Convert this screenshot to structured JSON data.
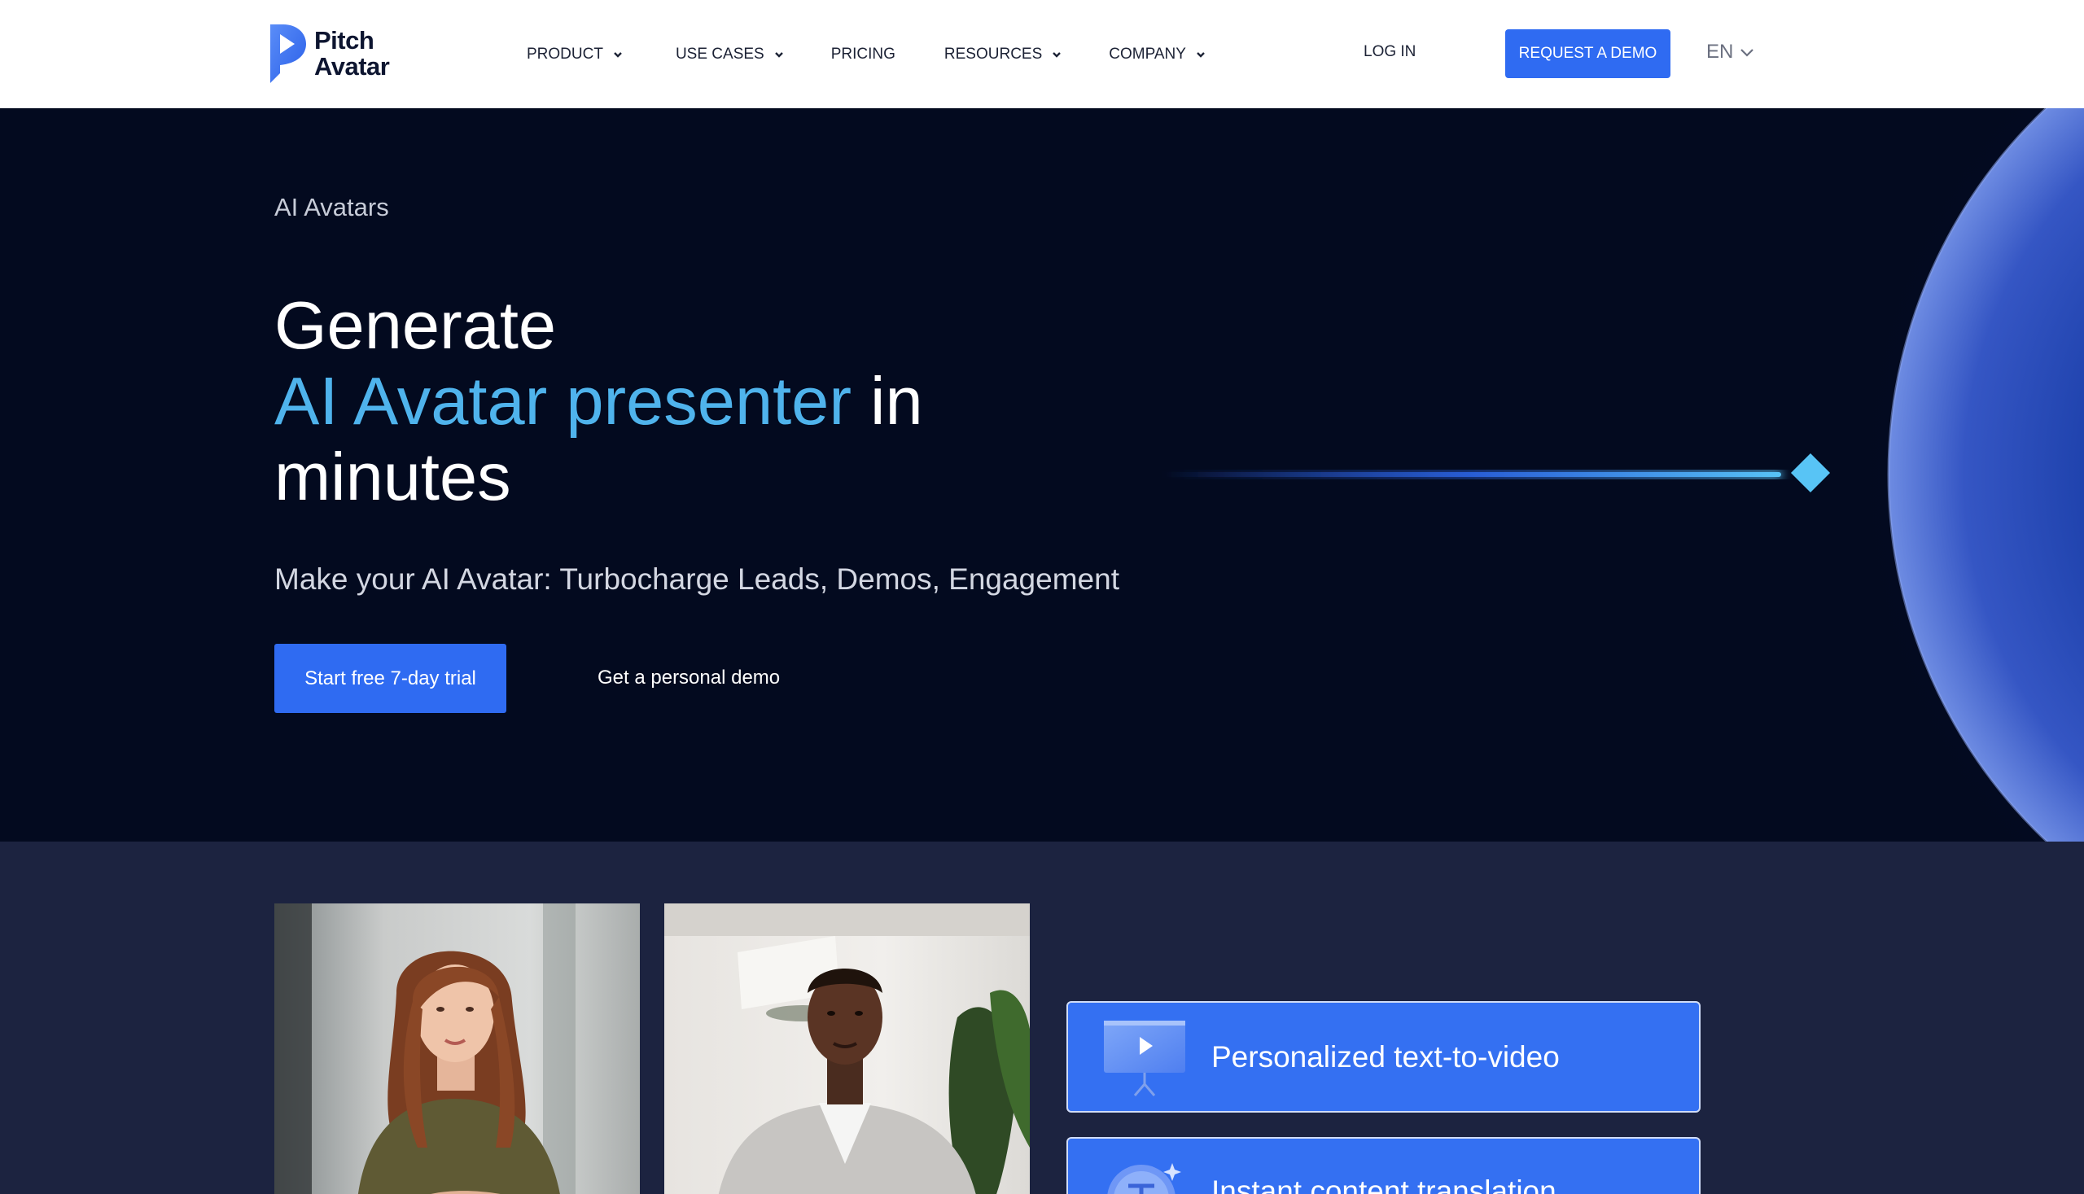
{
  "header": {
    "logo": {
      "line1": "Pitch",
      "line2": "Avatar"
    },
    "nav": [
      {
        "label": "PRODUCT",
        "has_dropdown": true
      },
      {
        "label": "USE CASES",
        "has_dropdown": true
      },
      {
        "label": "PRICING",
        "has_dropdown": false
      },
      {
        "label": "RESOURCES",
        "has_dropdown": true
      },
      {
        "label": "COMPANY",
        "has_dropdown": true
      }
    ],
    "login_label": "LOG IN",
    "demo_label": "REQUEST A DEMO",
    "language": "EN"
  },
  "hero": {
    "eyebrow": "AI Avatars",
    "headline_line1": "Generate",
    "headline_accent": "AI Avatar presenter",
    "headline_tail": " in",
    "headline_line3": "minutes",
    "subline": "Make your AI Avatar: Turbocharge Leads, Demos, Engagement",
    "primary_cta": "Start free 7-day trial",
    "secondary_cta": "Get a personal demo"
  },
  "features": [
    {
      "label": "Personalized text-to-video",
      "icon": "presentation-play-icon"
    },
    {
      "label": "Instant content translation",
      "icon": "translate-text-icon"
    }
  ],
  "avatars": [
    {
      "icon": "avatar-woman-photo"
    },
    {
      "icon": "avatar-man-photo"
    }
  ],
  "colors": {
    "brand_blue": "#2f6bf2",
    "accent_cyan": "#4fb3ec",
    "hero_bg": "#030a1f",
    "section_bg": "#1c2340",
    "feature_blue": "#3470f2"
  }
}
